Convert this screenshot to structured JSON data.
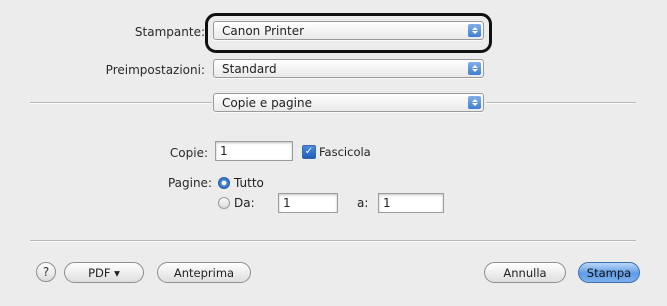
{
  "printer": {
    "label": "Stampante:",
    "value": "Canon Printer"
  },
  "presets": {
    "label": "Preimpostazioni:",
    "value": "Standard"
  },
  "section": {
    "value": "Copie e pagine"
  },
  "copies": {
    "label": "Copie:",
    "value": "1",
    "collate_label": "Fascicola",
    "collate_checked": true
  },
  "pages": {
    "label": "Pagine:",
    "all_label": "Tutto",
    "all_selected": true,
    "from_label": "Da:",
    "from_value": "1",
    "to_label": "a:",
    "to_value": "1"
  },
  "buttons": {
    "help": "?",
    "pdf": "PDF ▾",
    "preview": "Anteprima",
    "cancel": "Annulla",
    "print": "Stampa"
  },
  "colors": {
    "accent": "#3f7fd0",
    "highlight_border": "#111111"
  }
}
